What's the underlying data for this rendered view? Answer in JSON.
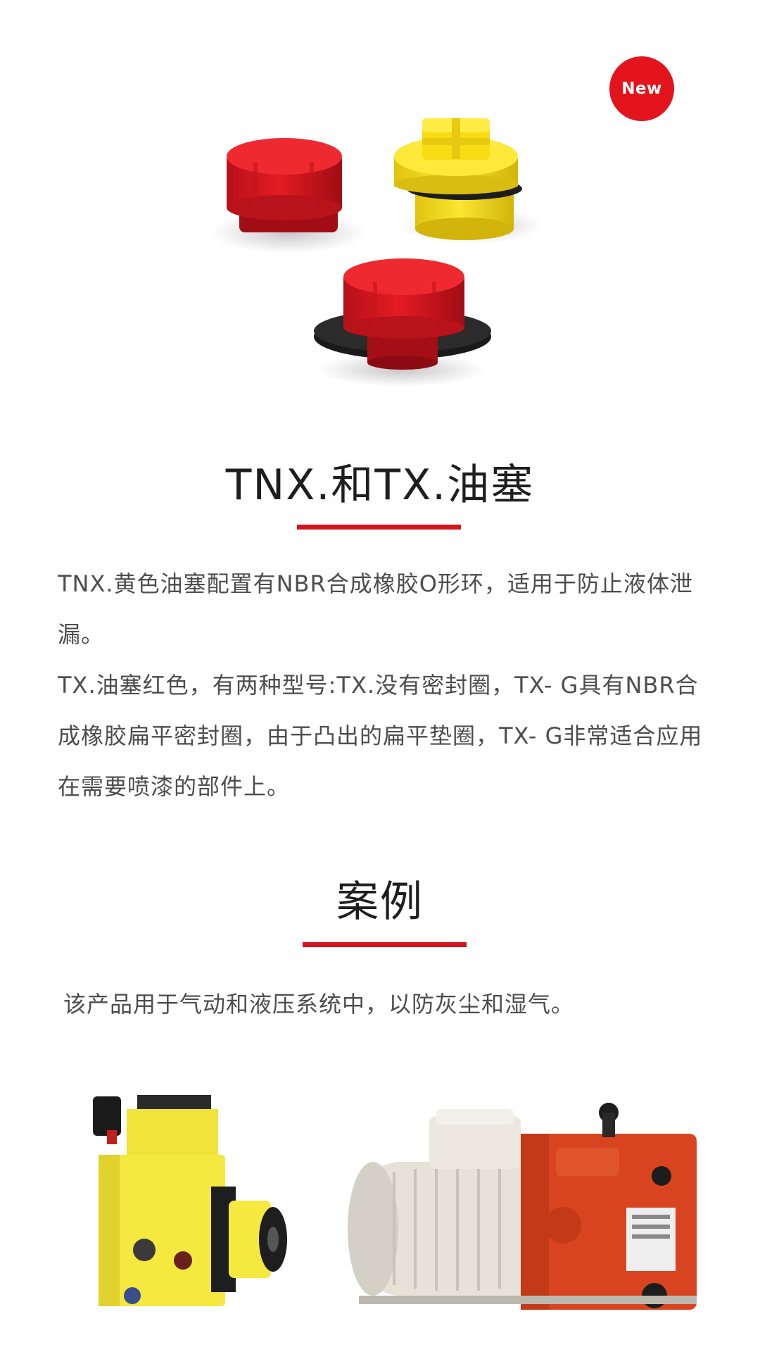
{
  "hero": {
    "badge": "New",
    "image_alt": "TNX and TX oil plugs"
  },
  "product": {
    "title": "TNX.和TX.油塞",
    "paragraphs": [
      "TNX.黄色油塞配置有NBR合成橡胶O形环，适用于防止液体泄漏。",
      "TX.油塞红色，有两种型号:TX.没有密封圈，TX- G具有NBR合成橡胶扁平密封圈，由于凸出的扁平垫圈，TX- G非常适合应用在需要喷漆的部件上。"
    ]
  },
  "cases": {
    "title": "案例",
    "text": "该产品用于气动和液压系统中，以防灰尘和湿气。"
  },
  "colors": {
    "accent_red": "#d3141d",
    "badge_red": "#e3141b",
    "plug_yellow": "#f4de1f",
    "motor_orange": "#d8441f"
  }
}
